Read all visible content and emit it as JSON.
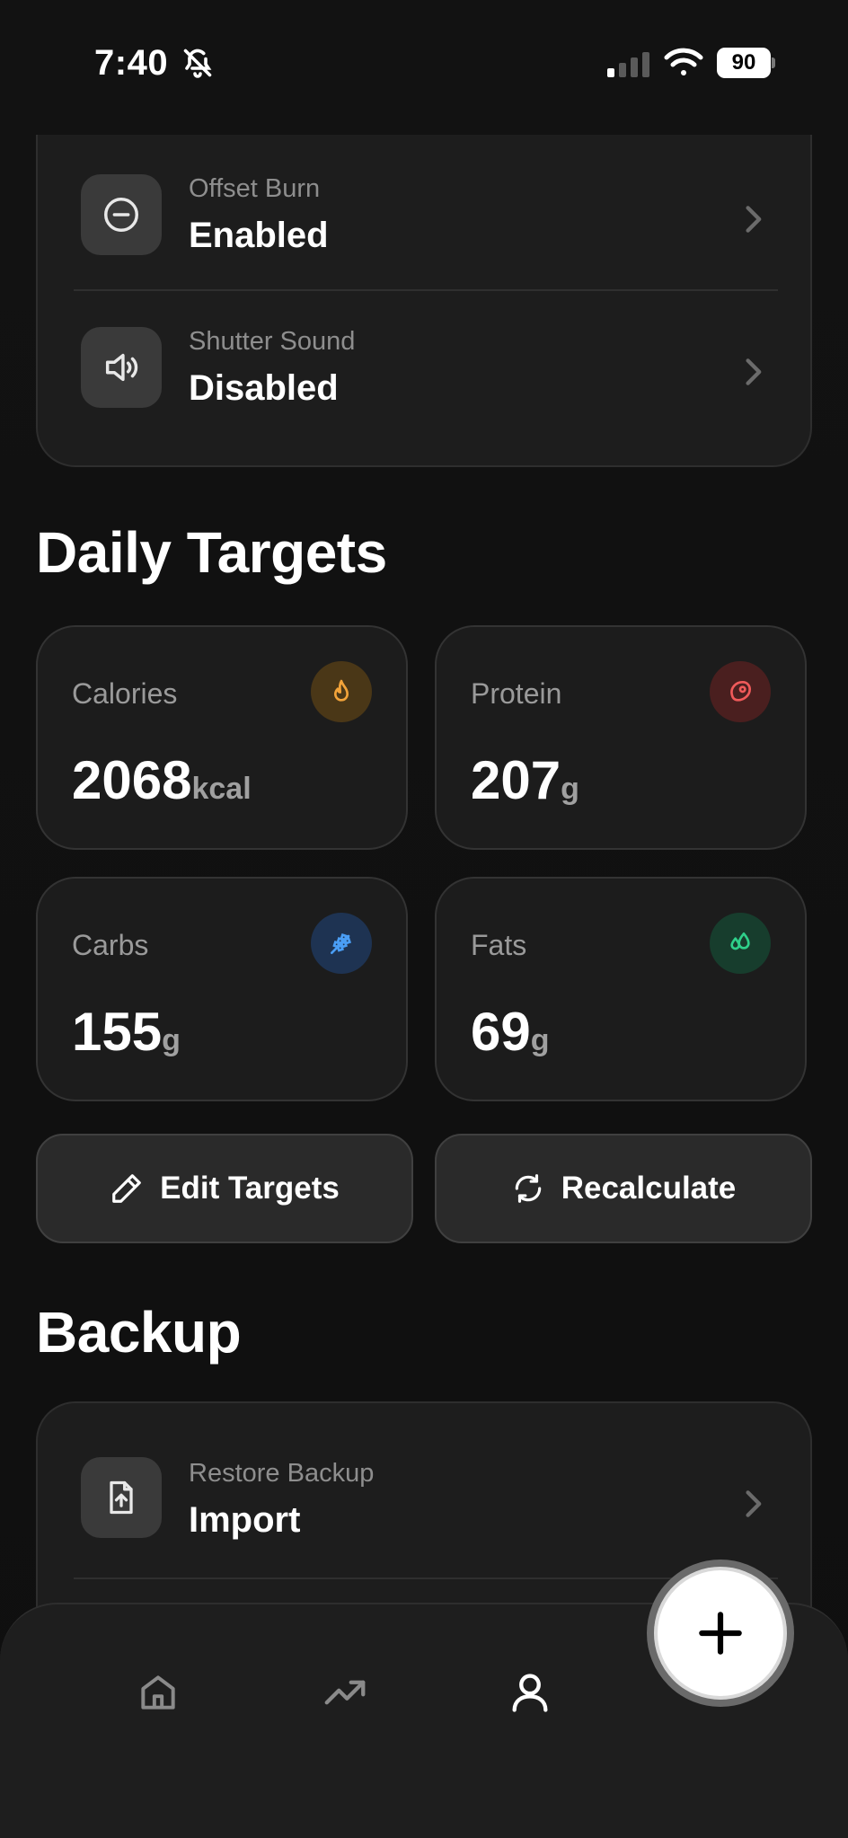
{
  "status_bar": {
    "time": "7:40",
    "battery": "90"
  },
  "settings": {
    "items": [
      {
        "label": "Offset Burn",
        "value": "Enabled",
        "icon": "minus-circle-icon"
      },
      {
        "label": "Shutter Sound",
        "value": "Disabled",
        "icon": "speaker-icon"
      }
    ]
  },
  "daily_targets": {
    "title": "Daily Targets",
    "cards": [
      {
        "label": "Calories",
        "value": "2068",
        "unit": "kcal",
        "icon": "flame-icon",
        "color": "#f2a33a"
      },
      {
        "label": "Protein",
        "value": "207",
        "unit": "g",
        "icon": "steak-icon",
        "color": "#f05a5a"
      },
      {
        "label": "Carbs",
        "value": "155",
        "unit": "g",
        "icon": "wheat-icon",
        "color": "#4a9ef5"
      },
      {
        "label": "Fats",
        "value": "69",
        "unit": "g",
        "icon": "droplets-icon",
        "color": "#2fd08a"
      }
    ],
    "edit_label": "Edit Targets",
    "recalc_label": "Recalculate"
  },
  "backup": {
    "title": "Backup",
    "items": [
      {
        "label": "Restore Backup",
        "value": "Import",
        "icon": "file-upload-icon"
      }
    ]
  },
  "nav": {
    "items": [
      "home-icon",
      "trending-up-icon",
      "user-icon"
    ],
    "fab_icon": "plus-icon"
  }
}
